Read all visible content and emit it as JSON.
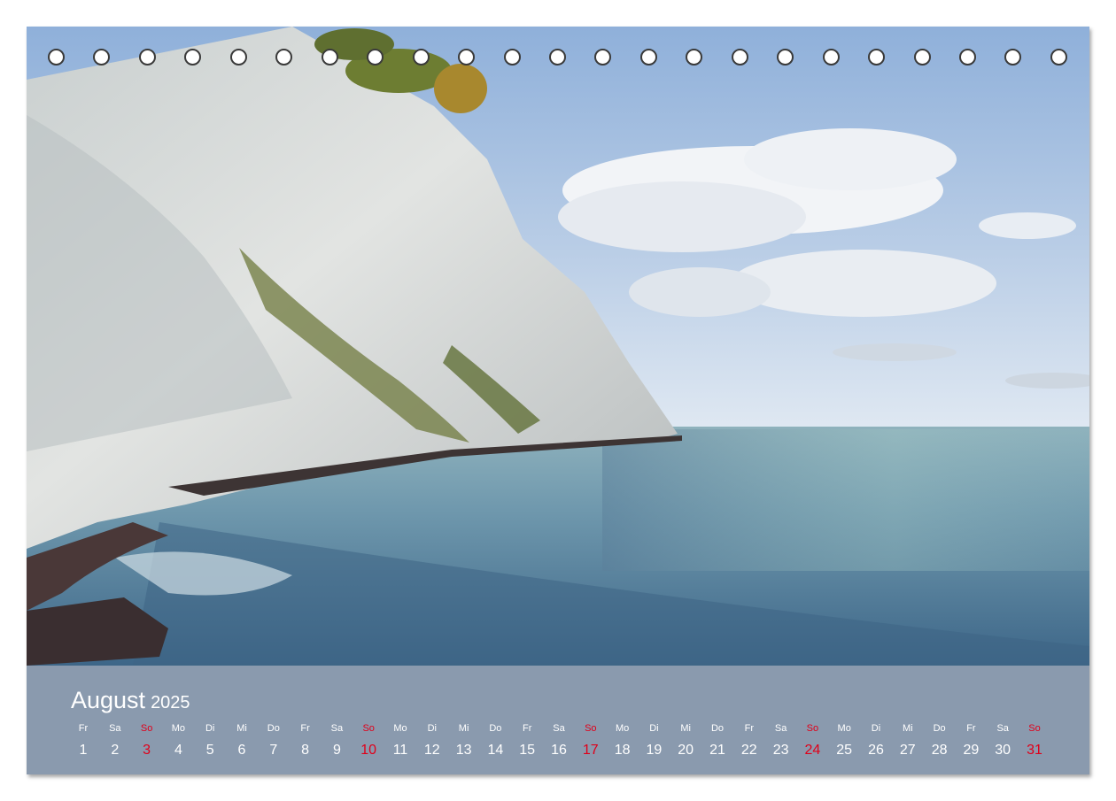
{
  "calendar": {
    "month": "August",
    "year": "2025",
    "sunday_color": "#e0001a",
    "text_color": "#ffffff",
    "bar_color": "#8a9aae",
    "days": [
      {
        "wd": "Fr",
        "n": "1"
      },
      {
        "wd": "Sa",
        "n": "2"
      },
      {
        "wd": "So",
        "n": "3"
      },
      {
        "wd": "Mo",
        "n": "4"
      },
      {
        "wd": "Di",
        "n": "5"
      },
      {
        "wd": "Mi",
        "n": "6"
      },
      {
        "wd": "Do",
        "n": "7"
      },
      {
        "wd": "Fr",
        "n": "8"
      },
      {
        "wd": "Sa",
        "n": "9"
      },
      {
        "wd": "So",
        "n": "10"
      },
      {
        "wd": "Mo",
        "n": "11"
      },
      {
        "wd": "Di",
        "n": "12"
      },
      {
        "wd": "Mi",
        "n": "13"
      },
      {
        "wd": "Do",
        "n": "14"
      },
      {
        "wd": "Fr",
        "n": "15"
      },
      {
        "wd": "Sa",
        "n": "16"
      },
      {
        "wd": "So",
        "n": "17"
      },
      {
        "wd": "Mo",
        "n": "18"
      },
      {
        "wd": "Di",
        "n": "19"
      },
      {
        "wd": "Mi",
        "n": "20"
      },
      {
        "wd": "Do",
        "n": "21"
      },
      {
        "wd": "Fr",
        "n": "22"
      },
      {
        "wd": "Sa",
        "n": "23"
      },
      {
        "wd": "So",
        "n": "24"
      },
      {
        "wd": "Mo",
        "n": "25"
      },
      {
        "wd": "Di",
        "n": "26"
      },
      {
        "wd": "Mi",
        "n": "27"
      },
      {
        "wd": "Do",
        "n": "28"
      },
      {
        "wd": "Fr",
        "n": "29"
      },
      {
        "wd": "Sa",
        "n": "30"
      },
      {
        "wd": "So",
        "n": "31"
      }
    ]
  },
  "binding": {
    "hole_count": 23
  }
}
